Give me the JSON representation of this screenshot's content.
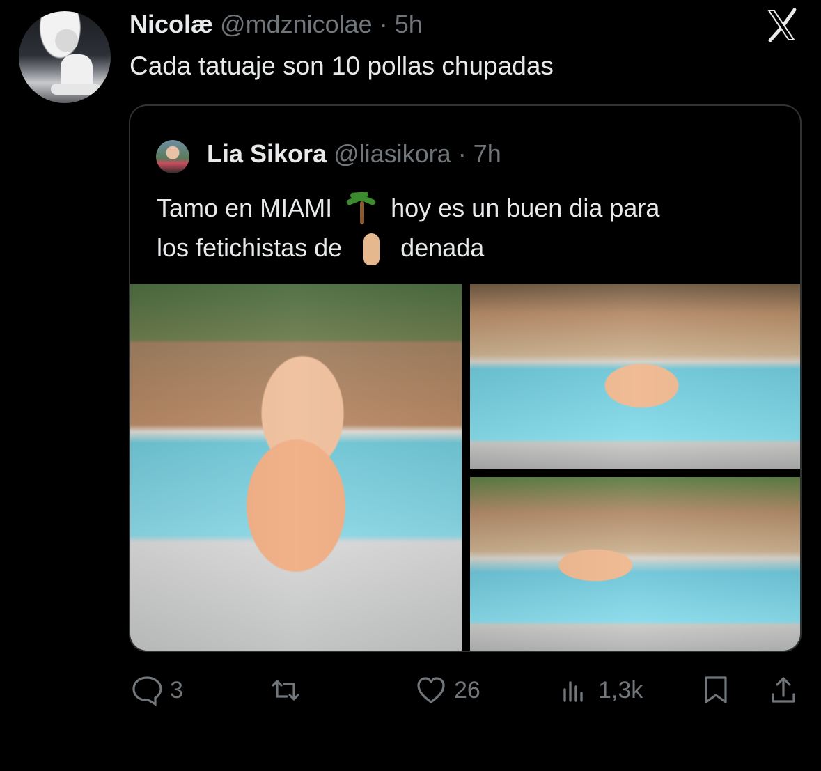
{
  "tweet": {
    "author_name": "Nicolæ",
    "handle": "@mdznicolae",
    "separator": "·",
    "time": "5h",
    "text": "Cada tatuaje son 10 pollas chupadas"
  },
  "quote": {
    "author_name": "Lia Sikora",
    "handle": "@liasikora",
    "separator": "·",
    "time": "7h",
    "line1_a": "Tamo en MIAMI",
    "line1_b": "hoy es un buen dia para",
    "line2_a": "los fetichistas de",
    "line2_b": "denada",
    "emoji_1": "palm-tree-icon",
    "emoji_2": "foot-icon"
  },
  "actions": {
    "replies": "3",
    "retweets": "",
    "likes": "26",
    "views": "1,3k"
  },
  "colors": {
    "background": "#000000",
    "text": "#e7e9ea",
    "muted": "#71767b",
    "border": "#2f3336"
  }
}
